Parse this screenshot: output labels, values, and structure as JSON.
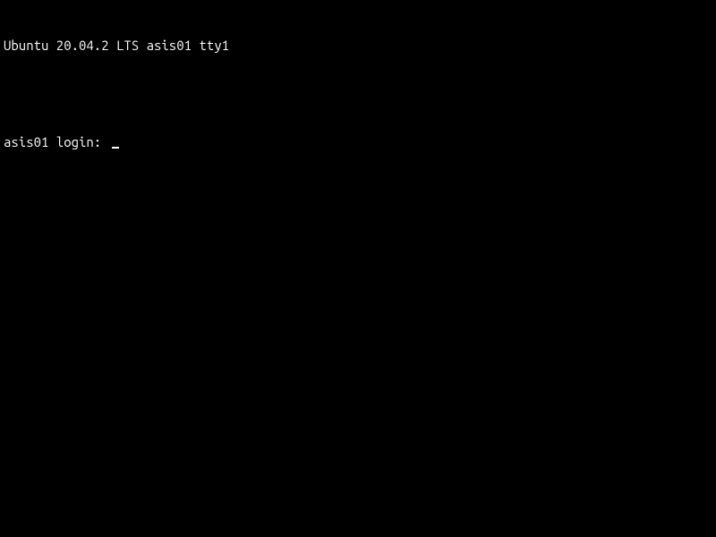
{
  "banner": "Ubuntu 20.04.2 LTS asis01 tty1",
  "login_prompt": "asis01 login: "
}
